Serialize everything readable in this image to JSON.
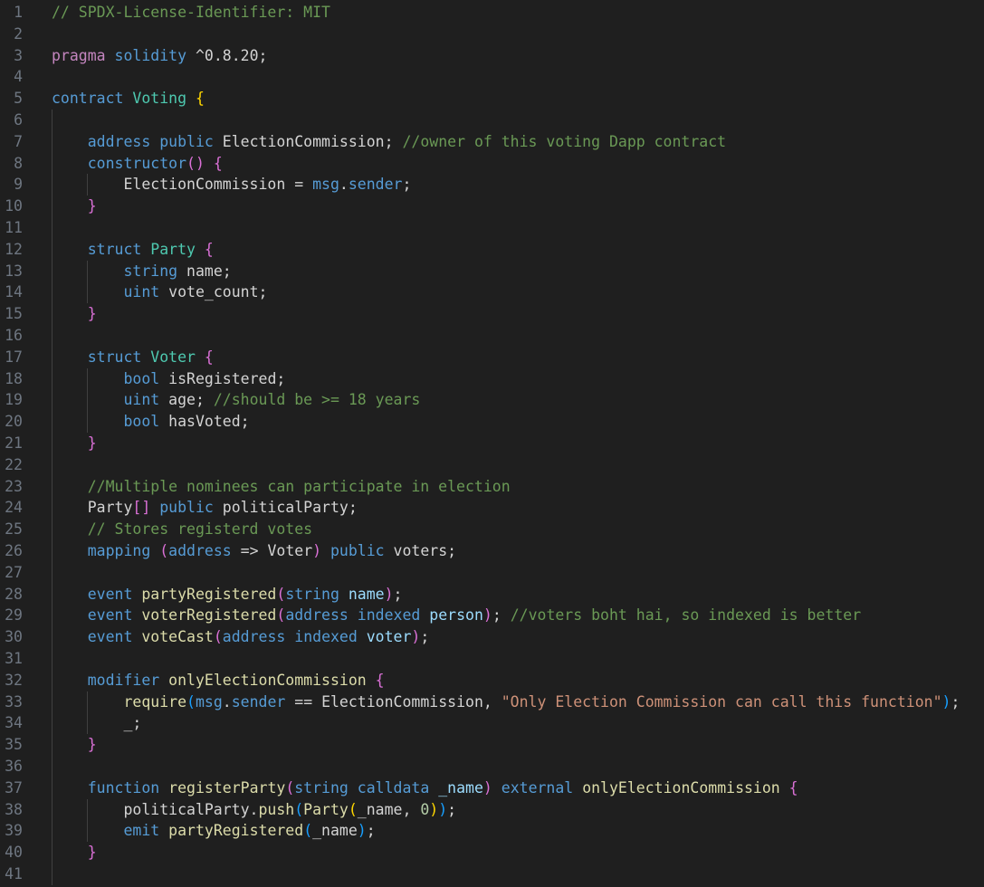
{
  "editor": {
    "language": "solidity",
    "lines": [
      [
        [
          "c",
          "// SPDX-License-Identifier: MIT"
        ]
      ],
      [],
      [
        [
          "cp",
          "pragma"
        ],
        [
          "p",
          " "
        ],
        [
          "k",
          "solidity"
        ],
        [
          "p",
          " ^0.8.20;"
        ]
      ],
      [],
      [
        [
          "k",
          "contract"
        ],
        [
          "p",
          " "
        ],
        [
          "t",
          "Voting"
        ],
        [
          "p",
          " "
        ],
        [
          "y",
          "{"
        ]
      ],
      [],
      [
        [
          "p",
          "    "
        ],
        [
          "k",
          "address"
        ],
        [
          "p",
          " "
        ],
        [
          "k",
          "public"
        ],
        [
          "p",
          " ElectionCommission; "
        ],
        [
          "c",
          "//owner of this voting Dapp contract"
        ]
      ],
      [
        [
          "p",
          "    "
        ],
        [
          "k",
          "constructor"
        ],
        [
          "m",
          "()"
        ],
        [
          "p",
          " "
        ],
        [
          "m",
          "{"
        ]
      ],
      [
        [
          "p",
          "        ElectionCommission = "
        ],
        [
          "k",
          "msg"
        ],
        [
          "p",
          "."
        ],
        [
          "k",
          "sender"
        ],
        [
          "p",
          ";"
        ]
      ],
      [
        [
          "p",
          "    "
        ],
        [
          "m",
          "}"
        ]
      ],
      [],
      [
        [
          "p",
          "    "
        ],
        [
          "k",
          "struct"
        ],
        [
          "p",
          " "
        ],
        [
          "t",
          "Party"
        ],
        [
          "p",
          " "
        ],
        [
          "m",
          "{"
        ]
      ],
      [
        [
          "p",
          "        "
        ],
        [
          "k",
          "string"
        ],
        [
          "p",
          " name;"
        ]
      ],
      [
        [
          "p",
          "        "
        ],
        [
          "k",
          "uint"
        ],
        [
          "p",
          " vote_count;"
        ]
      ],
      [
        [
          "p",
          "    "
        ],
        [
          "m",
          "}"
        ]
      ],
      [],
      [
        [
          "p",
          "    "
        ],
        [
          "k",
          "struct"
        ],
        [
          "p",
          " "
        ],
        [
          "t",
          "Voter"
        ],
        [
          "p",
          " "
        ],
        [
          "m",
          "{"
        ]
      ],
      [
        [
          "p",
          "        "
        ],
        [
          "k",
          "bool"
        ],
        [
          "p",
          " isRegistered;"
        ]
      ],
      [
        [
          "p",
          "        "
        ],
        [
          "k",
          "uint"
        ],
        [
          "p",
          " age; "
        ],
        [
          "c",
          "//should be >= 18 years"
        ]
      ],
      [
        [
          "p",
          "        "
        ],
        [
          "k",
          "bool"
        ],
        [
          "p",
          " hasVoted;"
        ]
      ],
      [
        [
          "p",
          "    "
        ],
        [
          "m",
          "}"
        ]
      ],
      [],
      [
        [
          "p",
          "    "
        ],
        [
          "c",
          "//Multiple nominees can participate in election"
        ]
      ],
      [
        [
          "p",
          "    Party"
        ],
        [
          "m",
          "[]"
        ],
        [
          "p",
          " "
        ],
        [
          "k",
          "public"
        ],
        [
          "p",
          " politicalParty;"
        ]
      ],
      [
        [
          "p",
          "    "
        ],
        [
          "c",
          "// Stores registerd votes"
        ]
      ],
      [
        [
          "p",
          "    "
        ],
        [
          "k",
          "mapping"
        ],
        [
          "p",
          " "
        ],
        [
          "m",
          "("
        ],
        [
          "k",
          "address"
        ],
        [
          "p",
          " => Voter"
        ],
        [
          "m",
          ")"
        ],
        [
          "p",
          " "
        ],
        [
          "k",
          "public"
        ],
        [
          "p",
          " voters;"
        ]
      ],
      [],
      [
        [
          "p",
          "    "
        ],
        [
          "k",
          "event"
        ],
        [
          "p",
          " "
        ],
        [
          "f",
          "partyRegistered"
        ],
        [
          "m",
          "("
        ],
        [
          "k",
          "string"
        ],
        [
          "p",
          " "
        ],
        [
          "v",
          "name"
        ],
        [
          "m",
          ")"
        ],
        [
          "p",
          ";"
        ]
      ],
      [
        [
          "p",
          "    "
        ],
        [
          "k",
          "event"
        ],
        [
          "p",
          " "
        ],
        [
          "f",
          "voterRegistered"
        ],
        [
          "m",
          "("
        ],
        [
          "k",
          "address"
        ],
        [
          "p",
          " "
        ],
        [
          "k",
          "indexed"
        ],
        [
          "p",
          " "
        ],
        [
          "v",
          "person"
        ],
        [
          "m",
          ")"
        ],
        [
          "p",
          "; "
        ],
        [
          "c",
          "//voters boht hai, so indexed is better"
        ]
      ],
      [
        [
          "p",
          "    "
        ],
        [
          "k",
          "event"
        ],
        [
          "p",
          " "
        ],
        [
          "f",
          "voteCast"
        ],
        [
          "m",
          "("
        ],
        [
          "k",
          "address"
        ],
        [
          "p",
          " "
        ],
        [
          "k",
          "indexed"
        ],
        [
          "p",
          " "
        ],
        [
          "v",
          "voter"
        ],
        [
          "m",
          ")"
        ],
        [
          "p",
          ";"
        ]
      ],
      [],
      [
        [
          "p",
          "    "
        ],
        [
          "k",
          "modifier"
        ],
        [
          "p",
          " "
        ],
        [
          "f",
          "onlyElectionCommission"
        ],
        [
          "p",
          " "
        ],
        [
          "m",
          "{"
        ]
      ],
      [
        [
          "p",
          "        "
        ],
        [
          "f",
          "require"
        ],
        [
          "b",
          "("
        ],
        [
          "k",
          "msg"
        ],
        [
          "p",
          "."
        ],
        [
          "k",
          "sender"
        ],
        [
          "p",
          " == ElectionCommission, "
        ],
        [
          "s",
          "\"Only Election Commission can call this function\""
        ],
        [
          "b",
          ")"
        ],
        [
          "p",
          ";"
        ]
      ],
      [
        [
          "p",
          "        _;"
        ]
      ],
      [
        [
          "p",
          "    "
        ],
        [
          "m",
          "}"
        ]
      ],
      [],
      [
        [
          "p",
          "    "
        ],
        [
          "k",
          "function"
        ],
        [
          "p",
          " "
        ],
        [
          "f",
          "registerParty"
        ],
        [
          "m",
          "("
        ],
        [
          "k",
          "string"
        ],
        [
          "p",
          " "
        ],
        [
          "k",
          "calldata"
        ],
        [
          "p",
          " "
        ],
        [
          "v",
          "_name"
        ],
        [
          "m",
          ")"
        ],
        [
          "p",
          " "
        ],
        [
          "k",
          "external"
        ],
        [
          "p",
          " "
        ],
        [
          "f",
          "onlyElectionCommission"
        ],
        [
          "p",
          " "
        ],
        [
          "m",
          "{"
        ]
      ],
      [
        [
          "p",
          "        politicalParty."
        ],
        [
          "f",
          "push"
        ],
        [
          "b",
          "("
        ],
        [
          "f",
          "Party"
        ],
        [
          "y",
          "("
        ],
        [
          "p",
          "_name, "
        ],
        [
          "n",
          "0"
        ],
        [
          "y",
          ")"
        ],
        [
          "b",
          ")"
        ],
        [
          "p",
          ";"
        ]
      ],
      [
        [
          "p",
          "        "
        ],
        [
          "k",
          "emit"
        ],
        [
          "p",
          " "
        ],
        [
          "f",
          "partyRegistered"
        ],
        [
          "b",
          "("
        ],
        [
          "p",
          "_name"
        ],
        [
          "b",
          ")"
        ],
        [
          "p",
          ";"
        ]
      ],
      [
        [
          "p",
          "    "
        ],
        [
          "m",
          "}"
        ]
      ],
      []
    ]
  }
}
